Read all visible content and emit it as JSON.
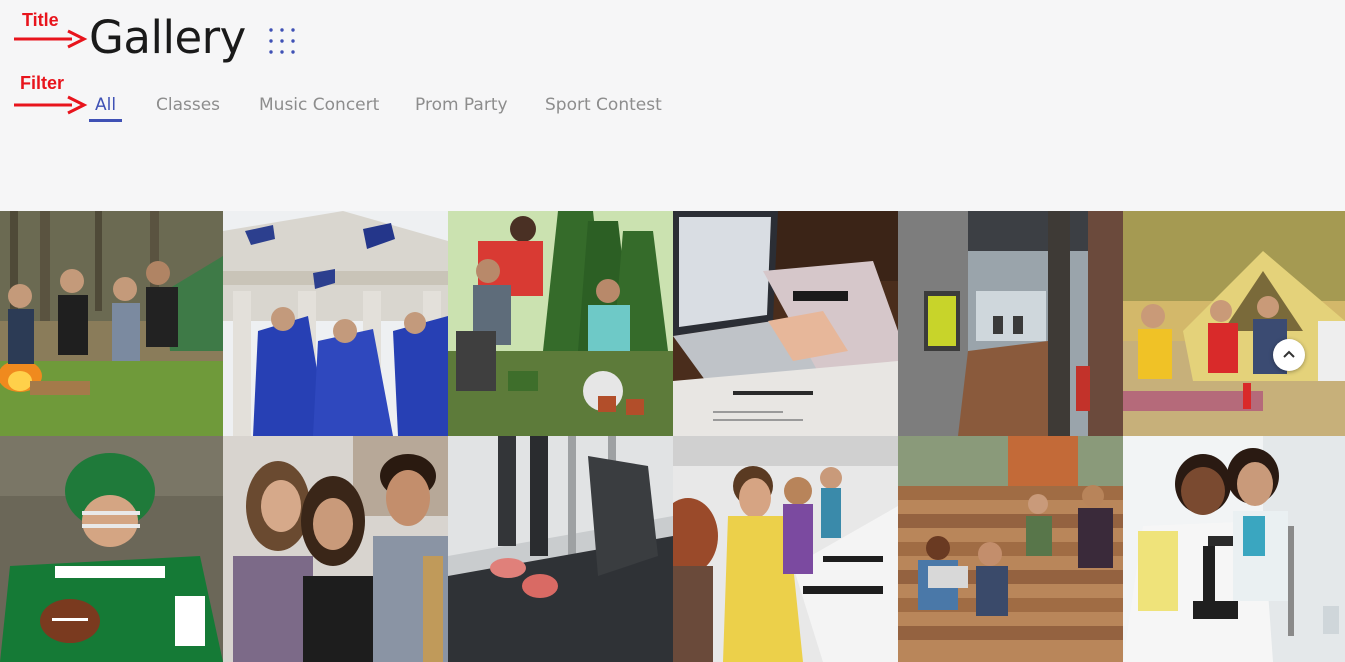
{
  "annotations": {
    "title_label": "Title",
    "filter_label": "Filter"
  },
  "header": {
    "title": "Gallery",
    "menu_icon": "grid-dots-icon"
  },
  "filters": {
    "items": [
      {
        "label": "All",
        "active": true
      },
      {
        "label": "Classes",
        "active": false
      },
      {
        "label": "Music Concert",
        "active": false
      },
      {
        "label": "Prom Party",
        "active": false
      },
      {
        "label": "Sport Contest",
        "active": false
      }
    ]
  },
  "gallery": {
    "photos": [
      {
        "subject": "friends-campfire-toast"
      },
      {
        "subject": "graduates-throwing-caps"
      },
      {
        "subject": "students-gardening"
      },
      {
        "subject": "laptop-typing"
      },
      {
        "subject": "office-hallway"
      },
      {
        "subject": "friends-camping-tent"
      },
      {
        "subject": "football-player"
      },
      {
        "subject": "three-friends-smiling"
      },
      {
        "subject": "treadmill-running"
      },
      {
        "subject": "students-computer-lab"
      },
      {
        "subject": "students-outdoor-steps"
      },
      {
        "subject": "lab-microscope"
      }
    ]
  },
  "scroll_top": {
    "icon": "chevron-up-icon"
  },
  "colors": {
    "accent": "#3f51b5",
    "annotation": "#e8141c",
    "background": "#f6f6f7",
    "inactive_tab": "#8d8d8d"
  }
}
